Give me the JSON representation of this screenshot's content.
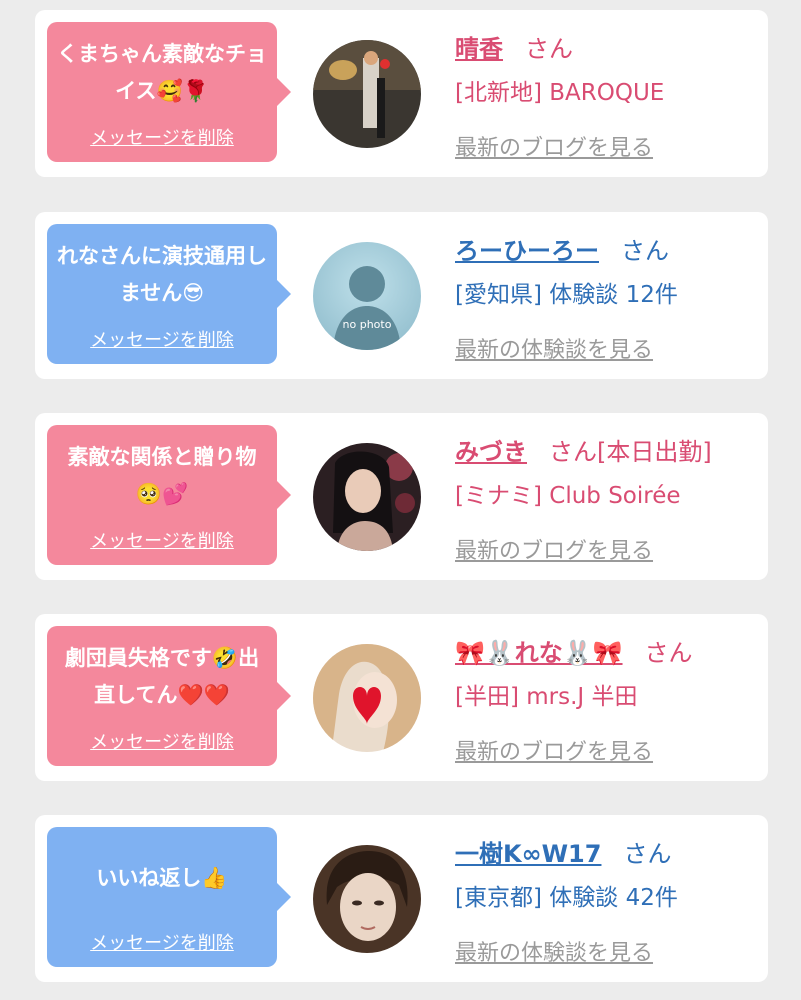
{
  "cards": [
    {
      "bubble_text": "くまちゃん素敵なチョイス🥰🌹",
      "delete_label": "メッセージを削除",
      "name": "晴香",
      "honorific": "さん",
      "detail": "[北新地] BAROQUE",
      "link_label": "最新のブログを見る",
      "avatar_caption": ""
    },
    {
      "bubble_text": "れなさんに演技通用しません😎",
      "delete_label": "メッセージを削除",
      "name": "ろーひーろー",
      "honorific": "さん",
      "detail": "[愛知県] 体験談 12件",
      "link_label": "最新の体験談を見る",
      "avatar_caption": "no photo"
    },
    {
      "bubble_text": "素敵な関係と贈り物🥺💕",
      "delete_label": "メッセージを削除",
      "name": "みづき",
      "honorific": "さん[本日出勤]",
      "detail": "[ミナミ] Club Soirée",
      "link_label": "最新のブログを見る",
      "avatar_caption": ""
    },
    {
      "bubble_text": "劇団員失格です🤣出直してん❤️❤️",
      "delete_label": "メッセージを削除",
      "name": "🎀🐰れな🐰🎀",
      "honorific": "さん",
      "detail": "[半田] mrs.J 半田",
      "link_label": "最新のブログを見る",
      "avatar_caption": ""
    },
    {
      "bubble_text": "いいね返し👍",
      "delete_label": "メッセージを削除",
      "name": "一樹K∞W17",
      "honorific": "さん",
      "detail": "[東京都] 体験談 42件",
      "link_label": "最新の体験談を見る",
      "avatar_caption": ""
    }
  ],
  "colors": {
    "pink_bubble": "#f4889c",
    "blue_bubble": "#7fb1f2",
    "pink_text": "#d94c72",
    "blue_text": "#2f6fb7",
    "link_gray": "#9a9a9a",
    "background": "#ececec"
  }
}
